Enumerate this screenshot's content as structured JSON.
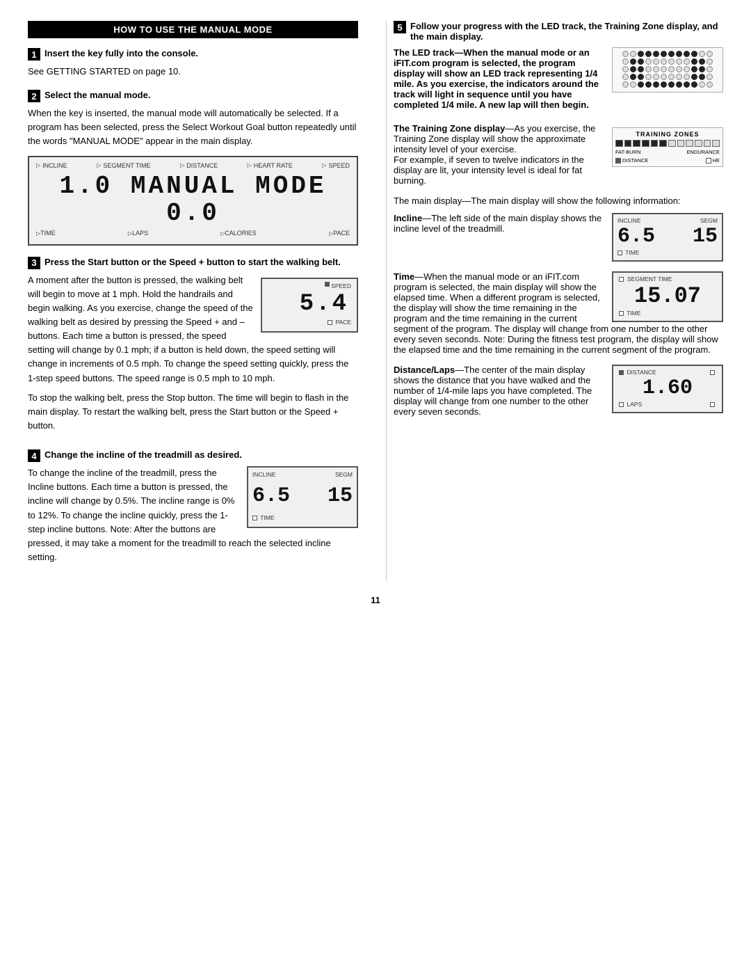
{
  "header": {
    "title": "HOW TO USE THE MANUAL MODE"
  },
  "left_col": {
    "step1": {
      "number": "1",
      "title": "Insert the key fully into the console.",
      "body": "See GETTING STARTED on page 10."
    },
    "step2": {
      "number": "2",
      "title": "Select the manual mode.",
      "body": "When the key is inserted, the manual mode will automatically be selected. If a program has been selected, press the Select Workout Goal button repeatedly until the words \"MANUAL MODE\" appear in the main display.",
      "lcd_labels_top": {
        "incline": "INCLINE",
        "seg_time": "SEGMENT TIME",
        "distance": "DISTANCE",
        "heart_rate": "HEART RATE",
        "speed": "SPEED"
      },
      "lcd_display": "1.0 MANUAL  MODE  0.0",
      "lcd_labels_bottom": {
        "time": "TIME",
        "laps": "LAPS",
        "calories": "CALORIES",
        "pace": "PACE"
      }
    },
    "step3": {
      "number": "3",
      "title": "Press the Start button or the Speed + button to start the walking belt.",
      "body1": "A moment after the button is pressed, the walking belt will begin to move at 1 mph. Hold the handrails and begin walking. As you exercise, change the speed of the walking belt as desired by pressing the Speed + and – buttons. Each time a button is pressed, the speed setting will change by 0.1 mph; if a button is held down, the speed setting will change in increments of 0.5 mph. To change the speed setting quickly, press the 1-step speed buttons. The speed range is 0.5 mph to 10 mph.",
      "speed_display_label": "SPEED",
      "speed_display_num": "5.4",
      "speed_display_bottom": "PACE",
      "body2": "To stop the walking belt, press the Stop button. The time will begin to flash in the main display. To restart the walking belt, press the Start button or the Speed + button."
    },
    "step4": {
      "number": "4",
      "title": "Change the incline of the treadmill as desired.",
      "body": "To change the incline of the treadmill, press the Incline buttons. Each time a button is pressed, the incline will change by 0.5%. The incline range is 0% to 12%. To change the incline quickly, press the 1-step incline buttons. Note: After the buttons are pressed, it may take a moment for the treadmill to reach the selected incline setting.",
      "incline_display": {
        "top_left": "INCLINE",
        "top_right": "SEGM",
        "left_num": "6.5",
        "right_num": "15",
        "bottom": "TIME"
      }
    }
  },
  "right_col": {
    "step5": {
      "number": "5",
      "title": "Follow your progress with the LED track, the Training Zone display, and the main display."
    },
    "led_track": {
      "title": "The LED track",
      "em_title": "The LED track",
      "desc": "When the manual mode or an iFIT.com program is selected, the program display will show an LED track representing 1/4 mile. As you exercise, the indicators around the track will light in sequence until you have completed 1/4 mile. A new lap will then begin.",
      "rows": [
        [
          0,
          0,
          1,
          1,
          1,
          1,
          1,
          1,
          1,
          1,
          0,
          0
        ],
        [
          0,
          1,
          1,
          0,
          0,
          0,
          0,
          0,
          0,
          1,
          1,
          0
        ],
        [
          0,
          1,
          1,
          0,
          0,
          0,
          0,
          0,
          0,
          1,
          1,
          0
        ],
        [
          0,
          1,
          1,
          0,
          0,
          0,
          0,
          0,
          0,
          1,
          1,
          0
        ],
        [
          0,
          0,
          1,
          1,
          1,
          1,
          1,
          1,
          1,
          1,
          0,
          0
        ]
      ]
    },
    "training_zones": {
      "title": "TRAINING ZONES",
      "bars": [
        1,
        1,
        1,
        1,
        1,
        1,
        0,
        0,
        0,
        0,
        0,
        0
      ],
      "label_left": "FAT-BURN",
      "label_right": "ENDURANCE",
      "sub_left": "DISTANCE",
      "sub_right": "HE"
    },
    "training_zone_text": {
      "title": "The Training Zone display",
      "em": "play",
      "desc": "As you exercise, the Training Zone display will show the approximate intensity level of your exercise.",
      "body2": "For example, if seven to twelve indicators in the display are lit, your intensity level is ideal for fat burning."
    },
    "main_display_intro": "The main display—The main display will show the following information:",
    "incline_section": {
      "title": "Incline",
      "em": "Incline",
      "desc": "The left side of the main display shows the incline level of the treadmill.",
      "display": {
        "top_left": "INCLINE",
        "top_right": "SEGM",
        "left_num": "6.5",
        "right_num": "15",
        "bottom": "TIME"
      }
    },
    "time_section": {
      "title": "Time",
      "em": "Time",
      "desc": "When the manual mode or an iFIT.com program is selected, the main display will show the elapsed time. When a different program is selected, the display will show the time remaining in the program and the time remaining in the current segment of the program. The display will change from one number to the other every seven seconds. Note: During the fitness test program, the display will show the elapsed time and the time remaining in the current segment of the program.",
      "display": {
        "top_label": "SEGMENT TIME",
        "num": "15.07",
        "bottom": "TIME"
      }
    },
    "distance_section": {
      "title": "Distance/Laps",
      "em": "Distance/Laps",
      "desc": "The center of the main display shows the distance that you have walked and the number of 1/4-mile laps you have completed. The display will change from one number to the other every seven seconds.",
      "display": {
        "top_label": "DISTANCE",
        "num": "1.60",
        "bottom_left": "LAPS",
        "bottom_right": ""
      }
    }
  },
  "page_number": "11"
}
